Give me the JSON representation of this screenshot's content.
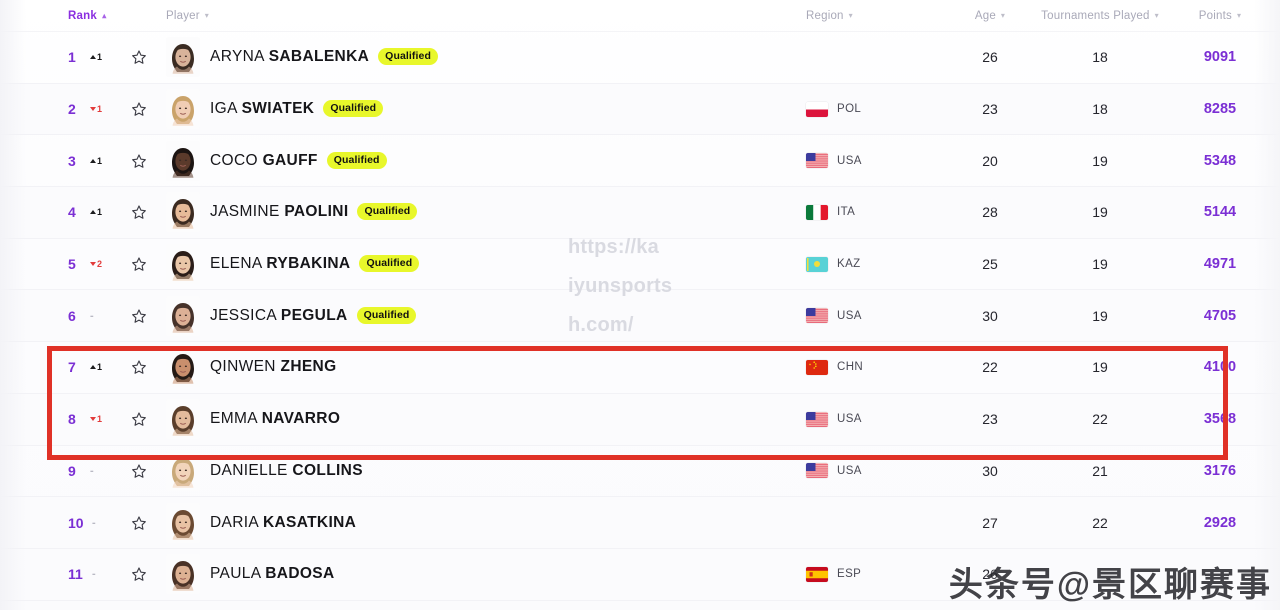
{
  "columns": {
    "rank": "Rank",
    "player": "Player",
    "region": "Region",
    "age": "Age",
    "tournaments": "Tournaments Played",
    "points": "Points"
  },
  "sort": {
    "column": "Rank",
    "direction": "asc"
  },
  "badge_label": "Qualified",
  "accent_color": "#7b2fd4",
  "badge_color": "#e8f72b",
  "highlight_color": "#e03127",
  "rows": [
    {
      "rank": "1",
      "delta": "1",
      "delta_dir": "up",
      "first": "ARYNA",
      "last": "SABALENKA",
      "qualified": true,
      "region_code": "",
      "flag": "none",
      "age": "26",
      "tournaments": "18",
      "points": "9091"
    },
    {
      "rank": "2",
      "delta": "1",
      "delta_dir": "down",
      "first": "IGA",
      "last": "SWIATEK",
      "qualified": true,
      "region_code": "POL",
      "flag": "pol",
      "age": "23",
      "tournaments": "18",
      "points": "8285"
    },
    {
      "rank": "3",
      "delta": "1",
      "delta_dir": "up",
      "first": "COCO",
      "last": "GAUFF",
      "qualified": true,
      "region_code": "USA",
      "flag": "usa",
      "age": "20",
      "tournaments": "19",
      "points": "5348"
    },
    {
      "rank": "4",
      "delta": "1",
      "delta_dir": "up",
      "first": "JASMINE",
      "last": "PAOLINI",
      "qualified": true,
      "region_code": "ITA",
      "flag": "ita",
      "age": "28",
      "tournaments": "19",
      "points": "5144"
    },
    {
      "rank": "5",
      "delta": "2",
      "delta_dir": "down",
      "first": "ELENA",
      "last": "RYBAKINA",
      "qualified": true,
      "region_code": "KAZ",
      "flag": "kaz",
      "age": "25",
      "tournaments": "19",
      "points": "4971"
    },
    {
      "rank": "6",
      "delta": "-",
      "delta_dir": "flat",
      "first": "JESSICA",
      "last": "PEGULA",
      "qualified": true,
      "region_code": "USA",
      "flag": "usa",
      "age": "30",
      "tournaments": "19",
      "points": "4705"
    },
    {
      "rank": "7",
      "delta": "1",
      "delta_dir": "up",
      "first": "QINWEN",
      "last": "ZHENG",
      "qualified": false,
      "region_code": "CHN",
      "flag": "chn",
      "age": "22",
      "tournaments": "19",
      "points": "4100"
    },
    {
      "rank": "8",
      "delta": "1",
      "delta_dir": "down",
      "first": "EMMA",
      "last": "NAVARRO",
      "qualified": false,
      "region_code": "USA",
      "flag": "usa",
      "age": "23",
      "tournaments": "22",
      "points": "3568"
    },
    {
      "rank": "9",
      "delta": "-",
      "delta_dir": "flat",
      "first": "DANIELLE",
      "last": "COLLINS",
      "qualified": false,
      "region_code": "USA",
      "flag": "usa",
      "age": "30",
      "tournaments": "21",
      "points": "3176"
    },
    {
      "rank": "10",
      "delta": "-",
      "delta_dir": "flat",
      "first": "DARIA",
      "last": "KASATKINA",
      "qualified": false,
      "region_code": "",
      "flag": "none",
      "age": "27",
      "tournaments": "22",
      "points": "2928"
    },
    {
      "rank": "11",
      "delta": "-",
      "delta_dir": "flat",
      "first": "PAULA",
      "last": "BADOSA",
      "qualified": false,
      "region_code": "ESP",
      "flag": "esp",
      "age": "26",
      "tournaments": "",
      "points": ""
    }
  ],
  "watermarks": {
    "url": "https://ka\niyunsports\nh.com/",
    "channel": "头条号@景区聊赛事"
  }
}
